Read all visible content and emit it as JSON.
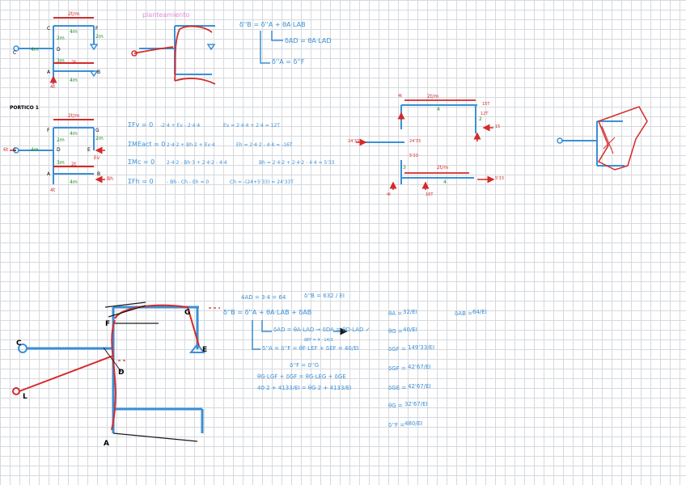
{
  "colors": {
    "blue": "#3b8fd6",
    "red": "#d42a2a",
    "green": "#1f8a1f",
    "black": "#1a1a1a",
    "pink": "#e08adf"
  },
  "top": {
    "heading": "planteamiento",
    "beam_load": "2t/m",
    "dims": [
      "4m",
      "4m",
      "2m",
      "2m",
      "3m",
      "2t",
      "4m",
      "4t"
    ],
    "nodes": [
      "C",
      "F",
      "C",
      "D",
      "A",
      "B"
    ],
    "eq1": "δ''B = δ''A + θA·LAB",
    "eq2": "δAD = θA·LAD",
    "eq3": "δ''A = δ''F"
  },
  "portico": {
    "title": "PORTICO 1",
    "load": "2t/m",
    "nodes": [
      "F",
      "G",
      "C",
      "D",
      "E",
      "A",
      "B"
    ],
    "labels": [
      "4m",
      "2m",
      "2m",
      "4m",
      "3m",
      "2t",
      "4m",
      "4t",
      "Ev",
      "Bh",
      "6t"
    ],
    "eqs": [
      {
        "lhs": "ΣFv = 0",
        "mid": "-2·4 + Ev - 2·4·4",
        "rhs": "Ev = 2·4·4 + 2·4 = 12T"
      },
      {
        "lhs": "ΣMEact = 0",
        "mid": "2·4·2 + Bh·2 + Ev·4",
        "rhs": "Eh = 2·4·2 - 4·4 = -16T"
      },
      {
        "lhs": "ΣMc = 0",
        "mid": "2·4·2 - Bh·3 + 2·4·2 - 4·4",
        "rhs": "Bh = 2·4·2 + 2·4·2 - 4·4 = 5'33"
      },
      {
        "lhs": "ΣFh = 0",
        "mid": "- Bh - Ch - Eh = 0",
        "rhs": "Ch = -(24+5'33) = 24'33T"
      }
    ]
  },
  "freebody": {
    "labels": [
      "2t/m",
      "4",
      "15T",
      "12T",
      "6",
      "533",
      "2",
      "3",
      "4t",
      "4t",
      "12T",
      "16T",
      "15",
      "24'33",
      "5'33",
      "2t/m",
      "4",
      "5'33",
      "24'33",
      "16T",
      "8T"
    ]
  },
  "bottom": {
    "formula_top": "4AD = 3·4 = 64",
    "formula_top_r": "δ''B = 632 / EI",
    "main_eq": "δ''B = δ''A + θA·LAB + δAB",
    "sub1": "δAD = θA·LAD → δDA = θD·LAD ✓",
    "sub2": "δ''A = δ''F = θF·LEF + δEF = 40/EI",
    "sub2b": "δEF = 4 · 14/3",
    "sub3": "δ''F = δ''G",
    "sub4": "θG·LGF + δGF = θG·LEG + δGE",
    "sub5": "40·2 + 4133/EI = θG·2 + 4133/EI",
    "nodes": [
      "G",
      "F",
      "E",
      "C",
      "D",
      "A",
      "L"
    ],
    "results": [
      {
        "k": "θA =",
        "v": "32/EI"
      },
      {
        "k": "θG =",
        "v": "40/EI"
      },
      {
        "k": "δGF =",
        "v": "149'33/EI"
      },
      {
        "k": "δGF =",
        "v": "42'67/EI"
      },
      {
        "k": "δGE =",
        "v": "42'67/EI"
      },
      {
        "k": "θG =",
        "v": "32'67/EI"
      },
      {
        "k": "δ''F =",
        "v": "480/EI"
      }
    ],
    "side": {
      "k": "δAB =",
      "v": "64/EI"
    }
  }
}
